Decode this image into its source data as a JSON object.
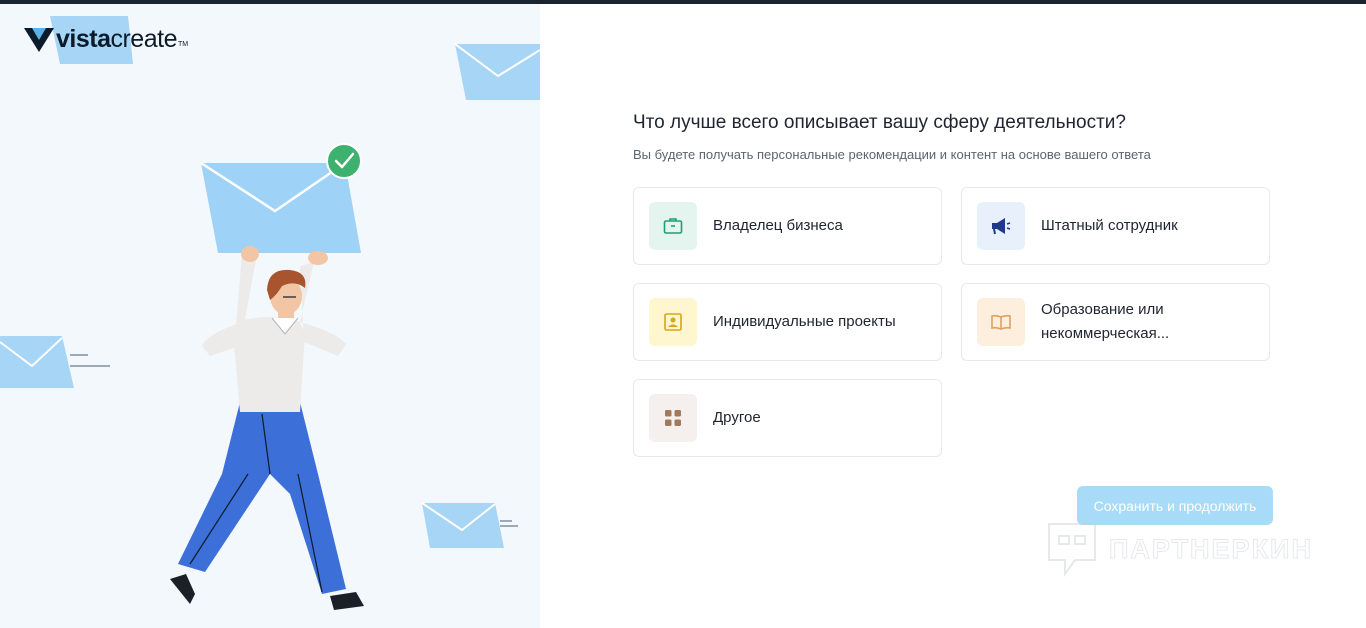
{
  "brand": {
    "logo_bold": "vista",
    "logo_light": "create",
    "logo_tm": "TM"
  },
  "question": {
    "title": "Что лучше всего описывает вашу сферу деятельности?",
    "subtitle": "Вы будете получать персональные рекомендации и контент на основе вашего ответа"
  },
  "options": [
    {
      "label": "Владелец бизнеса",
      "icon": "briefcase-icon",
      "color": "#1d9f74"
    },
    {
      "label": "Штатный сотрудник",
      "icon": "megaphone-icon",
      "color": "#1f3a8a"
    },
    {
      "label": "Индивидуальные проекты",
      "icon": "portrait-icon",
      "color": "#d9a418"
    },
    {
      "label": "Образование или некоммерческая...",
      "icon": "book-icon",
      "color": "#e0a060"
    },
    {
      "label": "Другое",
      "icon": "grid-icon",
      "color": "#a07a5a"
    }
  ],
  "actions": {
    "save_label": "Сохранить и продолжить",
    "accent": "#a7dbf7"
  },
  "watermark": {
    "text": "ПАРТНЕРКИН"
  }
}
